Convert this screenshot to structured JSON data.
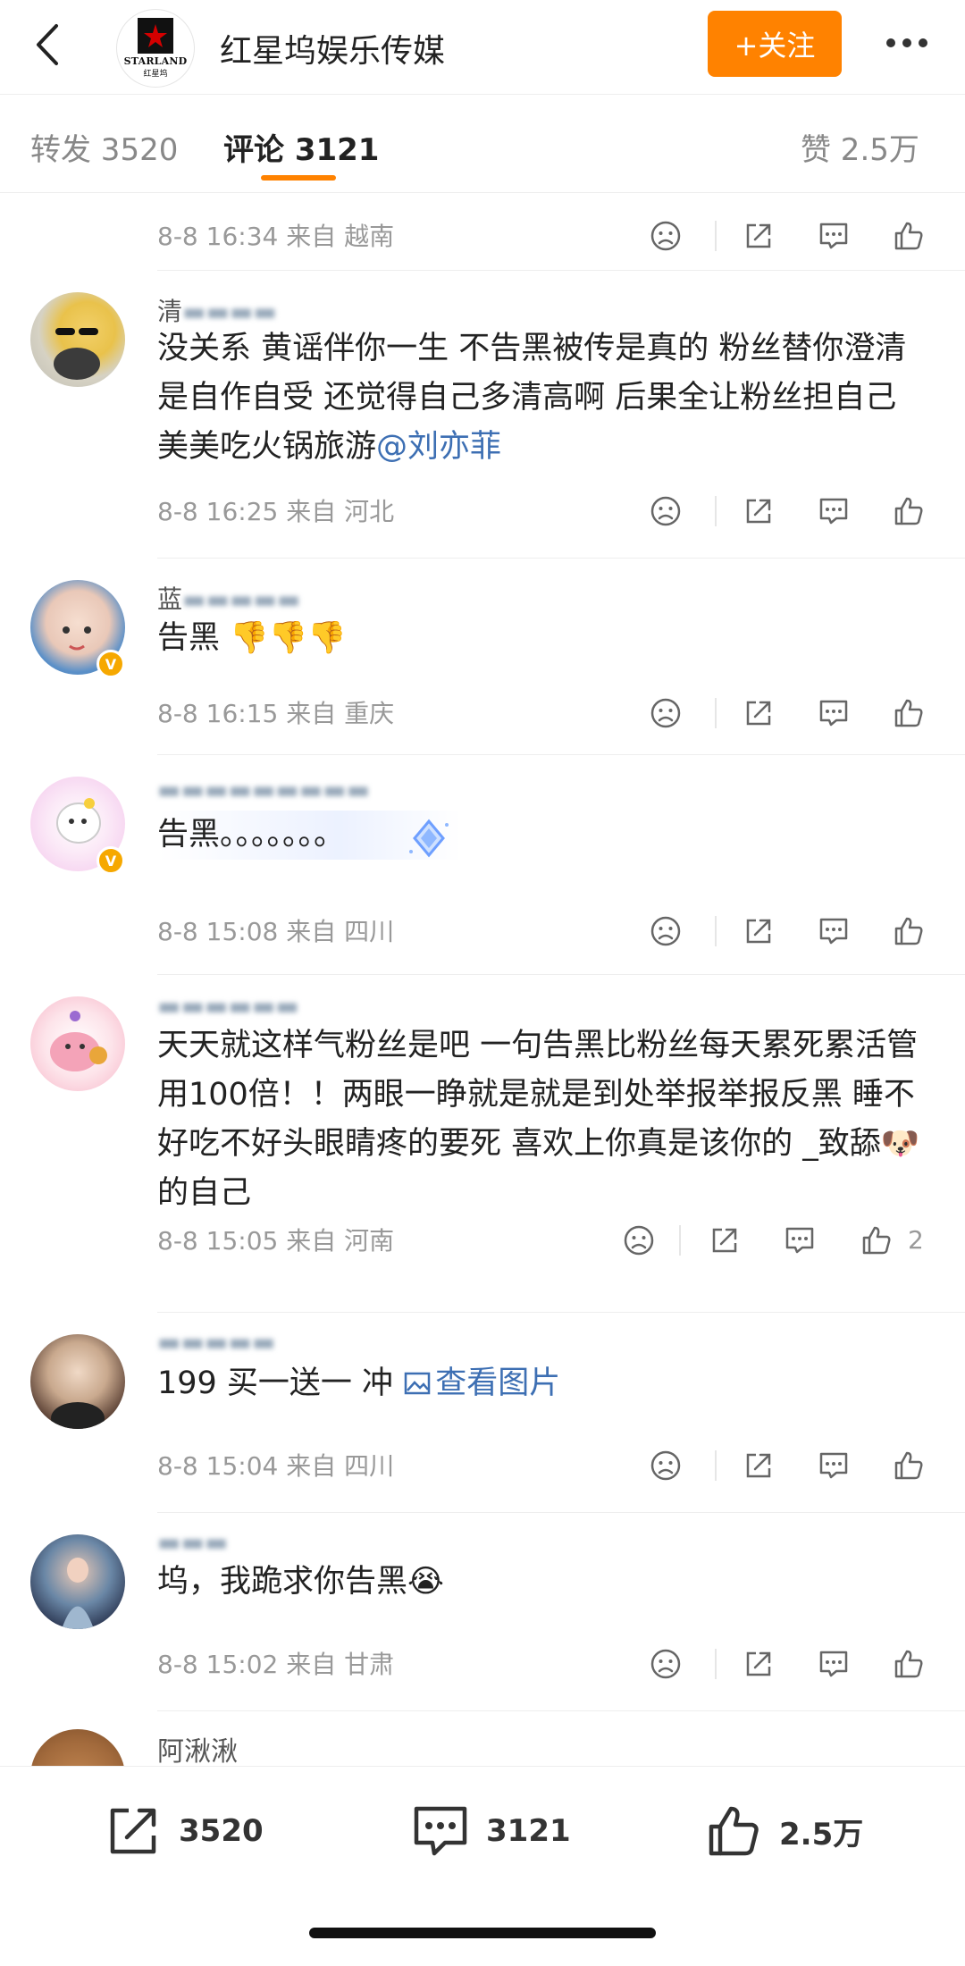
{
  "header": {
    "title": "红星坞娱乐传媒",
    "logo_text": "STARLAND",
    "logo_subtext": "红星坞",
    "follow_label": "+关注"
  },
  "tabs": [
    {
      "label": "转发 3520",
      "active": false
    },
    {
      "label": "评论 3121",
      "active": true
    },
    {
      "label": "赞 2.5万",
      "active": false
    }
  ],
  "accent_color": "#ff8200",
  "link_color": "#3d6fb3",
  "comments": [
    {
      "username": "",
      "content": "",
      "meta": "8-8 16:34 来自 越南",
      "likes": ""
    },
    {
      "username": "清",
      "content_parts": [
        "没关系 黄谣伴你一生 不告黑被传是真的 粉丝替你澄清是自作自受 还觉得自己多清高啊 后果全让粉丝担自己美美吃火锅旅游",
        "@刘亦菲"
      ],
      "meta": "8-8 16:25 来自 河北",
      "likes": ""
    },
    {
      "username": "蓝",
      "content": "告黑",
      "emoji": "👎👎👎",
      "meta": "8-8 16:15 来自 重庆",
      "likes": ""
    },
    {
      "username": "",
      "content": "告黑。。。。。。。",
      "meta": "8-8 15:08 来自 四川",
      "likes": ""
    },
    {
      "username": "",
      "content_parts": [
        "天天就这样气粉丝是吧  一句告黑比粉丝每天累死累活管用100倍！！两眼一睁就是就是到处举报举报反黑  睡不好吃不好头眼睛疼的要死  喜欢上你真是该你的  _致舔",
        "🐶",
        "的自己"
      ],
      "meta": "8-8 15:05 来自 河南",
      "likes": "2"
    },
    {
      "username": "",
      "content_parts": [
        "199 买一送一 冲 ",
        "查看图片"
      ],
      "meta": "8-8 15:04 来自 四川",
      "likes": ""
    },
    {
      "username": "",
      "content_parts": [
        "坞，我跪求你告黑",
        "😭"
      ],
      "meta": "8-8 15:02 来自 甘肃",
      "likes": ""
    },
    {
      "username": "阿湫湫",
      "content": "",
      "meta": "",
      "likes": ""
    }
  ],
  "bottom_bar": {
    "repost_count": "3520",
    "comment_count": "3121",
    "like_count": "2.5万"
  },
  "icons": [
    "back-arrow-icon",
    "more-dots-icon",
    "dislike-face-icon",
    "share-icon",
    "comment-icon",
    "like-thumb-icon",
    "picture-icon"
  ]
}
